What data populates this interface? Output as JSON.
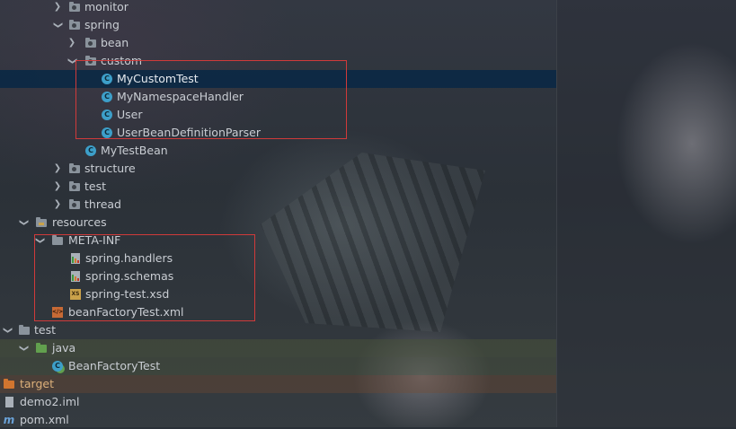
{
  "project_tree": {
    "items": [
      {
        "label": "monitor",
        "icon": "package-folder-icon",
        "expanded": false
      },
      {
        "label": "spring",
        "icon": "package-folder-icon",
        "expanded": true
      },
      {
        "label": "bean",
        "icon": "package-folder-icon",
        "expanded": false
      },
      {
        "label": "custom",
        "icon": "package-folder-icon",
        "expanded": true
      },
      {
        "label": "MyCustomTest",
        "icon": "java-class-icon",
        "selected": true
      },
      {
        "label": "MyNamespaceHandler",
        "icon": "java-class-icon"
      },
      {
        "label": "User",
        "icon": "java-class-icon"
      },
      {
        "label": "UserBeanDefinitionParser",
        "icon": "java-class-icon"
      },
      {
        "label": "MyTestBean",
        "icon": "java-class-icon"
      },
      {
        "label": "structure",
        "icon": "package-folder-icon",
        "expanded": false
      },
      {
        "label": "test",
        "icon": "package-folder-icon",
        "expanded": false
      },
      {
        "label": "thread",
        "icon": "package-folder-icon",
        "expanded": false
      },
      {
        "label": "resources",
        "icon": "resources-folder-icon",
        "expanded": true
      },
      {
        "label": "META-INF",
        "icon": "folder-icon",
        "expanded": true
      },
      {
        "label": "spring.handlers",
        "icon": "properties-file-icon"
      },
      {
        "label": "spring.schemas",
        "icon": "properties-file-icon"
      },
      {
        "label": "spring-test.xsd",
        "icon": "xsd-file-icon"
      },
      {
        "label": "beanFactoryTest.xml",
        "icon": "xml-file-icon"
      },
      {
        "label": "test",
        "icon": "folder-icon",
        "expanded": true
      },
      {
        "label": "java",
        "icon": "test-sources-folder-icon",
        "expanded": true
      },
      {
        "label": "BeanFactoryTest",
        "icon": "test-class-icon"
      },
      {
        "label": "target",
        "icon": "excluded-folder-icon"
      },
      {
        "label": "demo2.iml",
        "icon": "iml-file-icon"
      },
      {
        "label": "pom.xml",
        "icon": "maven-file-icon"
      }
    ]
  },
  "colors": {
    "selection": "#0d2944",
    "highlight_box": "#d03a3a",
    "class_icon": "#3d9fc9",
    "excluded_folder": "#d2752f",
    "test_folder": "#62a04e"
  }
}
